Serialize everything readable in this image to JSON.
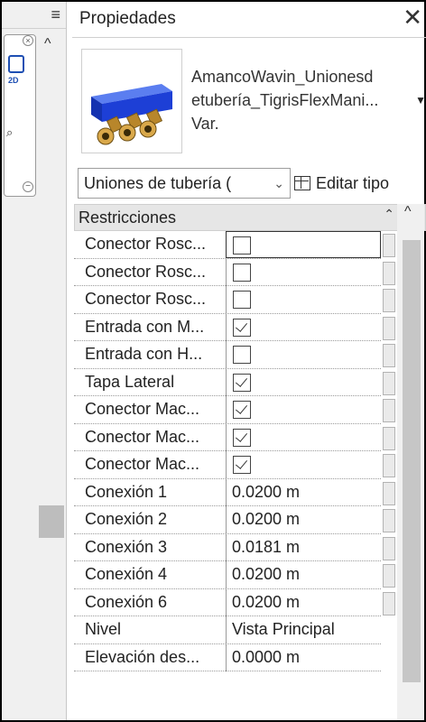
{
  "panel": {
    "title": "Propiedades",
    "close_glyph": "✕",
    "type_name": "AmancoWavin_Unionesdetubería_TigrisFlexMani... Var.",
    "type_line1": "AmancoWavin_Unionesd",
    "type_line2": "etubería_TigrisFlexMani...",
    "type_line3": "Var.",
    "filter_value": "Uniones de tubería (",
    "edit_type_label": "Editar tipo",
    "section": "Restricciones"
  },
  "rows": [
    {
      "name": "Conector Rosc...",
      "type": "checkbox",
      "checked": false,
      "focus": true
    },
    {
      "name": "Conector Rosc...",
      "type": "checkbox",
      "checked": false
    },
    {
      "name": "Conector Rosc...",
      "type": "checkbox",
      "checked": false
    },
    {
      "name": "Entrada con M...",
      "type": "checkbox",
      "checked": true
    },
    {
      "name": "Entrada con H...",
      "type": "checkbox",
      "checked": false
    },
    {
      "name": "Tapa Lateral",
      "type": "checkbox",
      "checked": true
    },
    {
      "name": "Conector Mac...",
      "type": "checkbox",
      "checked": true
    },
    {
      "name": "Conector Mac...",
      "type": "checkbox",
      "checked": true
    },
    {
      "name": "Conector Mac...",
      "type": "checkbox",
      "checked": true
    },
    {
      "name": "Conexión 1",
      "type": "text",
      "value": "0.0200 m"
    },
    {
      "name": "Conexión 2",
      "type": "text",
      "value": "0.0200 m"
    },
    {
      "name": "Conexión 3",
      "type": "text",
      "value": "0.0181 m"
    },
    {
      "name": "Conexión 4",
      "type": "text",
      "value": "0.0200 m"
    },
    {
      "name": "Conexión 6",
      "type": "text",
      "value": "0.0200 m"
    },
    {
      "name": "Nivel",
      "type": "text",
      "value": "Vista Principal"
    },
    {
      "name": "Elevación des...",
      "type": "text",
      "value": "0.0000 m"
    }
  ],
  "left_nav": {
    "label_2d": "2D"
  },
  "icons": {
    "menu": "hamburger-icon",
    "close": "close-icon",
    "caret": "chevron-up-icon",
    "dropdown": "chevron-down-icon",
    "edit_type": "edit-type-icon",
    "collapse": "double-chevron-up-icon",
    "thumbnail": "manifold-pipe-thumbnail"
  },
  "colors": {
    "manifold_blue": "#1d3fd6",
    "fitting_brass": "#b8862b",
    "accent_nav": "#1e4fb3"
  }
}
